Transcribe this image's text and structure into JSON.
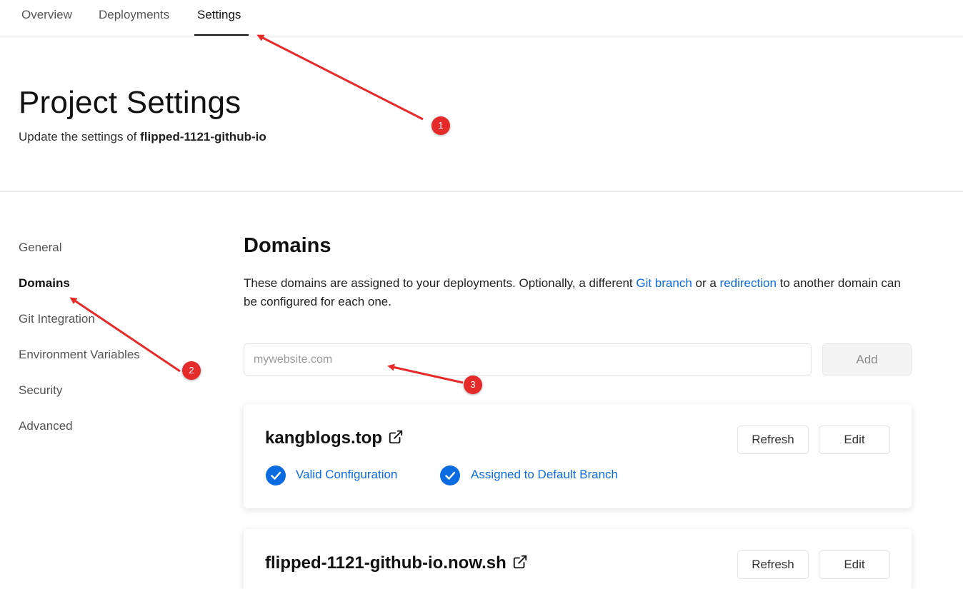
{
  "nav": {
    "tabs": [
      "Overview",
      "Deployments",
      "Settings"
    ],
    "active_tab": "Settings"
  },
  "header": {
    "title": "Project Settings",
    "subtitle_prefix": "Update the settings of",
    "project_name": "flipped-1121-github-io"
  },
  "sidebar": {
    "items": [
      "General",
      "Domains",
      "Git Integration",
      "Environment Variables",
      "Security",
      "Advanced"
    ],
    "active": "Domains"
  },
  "domains": {
    "title": "Domains",
    "desc_part1": "These domains are assigned to your deployments. Optionally, a different ",
    "desc_link1": "Git branch",
    "desc_part2": " or a ",
    "desc_link2": "redirection",
    "desc_part3": " to another domain can be configured for each one.",
    "input_placeholder": "mywebsite.com",
    "input_value": "",
    "add_label": "Add",
    "list": [
      {
        "name": "kangblogs.top",
        "refresh_label": "Refresh",
        "edit_label": "Edit",
        "statuses": [
          "Valid Configuration",
          "Assigned to Default Branch"
        ]
      },
      {
        "name": "flipped-1121-github-io.now.sh",
        "refresh_label": "Refresh",
        "edit_label": "Edit"
      }
    ]
  },
  "annotations": {
    "markers": [
      "1",
      "2",
      "3"
    ],
    "color": "#e52a2a"
  },
  "colors": {
    "link": "#0b6be0",
    "text": "#111111",
    "border": "#e5e5e5"
  }
}
